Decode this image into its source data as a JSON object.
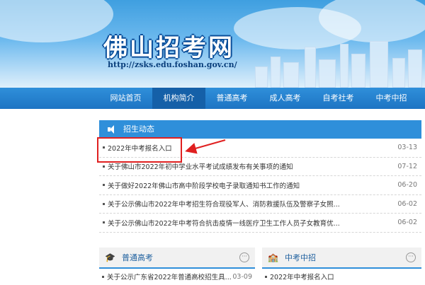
{
  "header": {
    "site_title": "佛山招考网",
    "site_url": "http://zsks.edu.foshan.gov.cn/"
  },
  "nav": {
    "items": [
      {
        "label": "网站首页",
        "active": false
      },
      {
        "label": "机构简介",
        "active": true
      },
      {
        "label": "普通高考",
        "active": false
      },
      {
        "label": "成人高考",
        "active": false
      },
      {
        "label": "自考社考",
        "active": false
      },
      {
        "label": "中考中招",
        "active": false
      }
    ]
  },
  "news": {
    "heading": "招生动态",
    "items": [
      {
        "title": "2022年中考报名入口",
        "date": "03-13"
      },
      {
        "title": "关于佛山市2022年初中学业水平考试成绩发布有关事项的通知",
        "date": "07-12"
      },
      {
        "title": "关于做好2022年佛山市高中阶段学校电子录取通知书工作的通知",
        "date": "06-20"
      },
      {
        "title": "关于公示佛山市2022年中考招生符合现役军人、消防救援队伍及警察子女照...",
        "date": "06-02"
      },
      {
        "title": "关于公示佛山市2022年中考符合抗击疫情一线医疗卫生工作人员子女教育优...",
        "date": "06-02"
      }
    ]
  },
  "sections": {
    "gaokao": {
      "heading": "普通高考",
      "more": "···",
      "items": [
        {
          "title": "关于公示广东省2022年普通高校招生具...",
          "date": "03-09"
        }
      ]
    },
    "zhongkao": {
      "heading": "中考中招",
      "more": "···",
      "items": [
        {
          "title": "2022年中考报名入口",
          "date": ""
        }
      ]
    }
  },
  "colors": {
    "nav_blue": "#2f8fda",
    "highlight_red": "#e02020"
  }
}
